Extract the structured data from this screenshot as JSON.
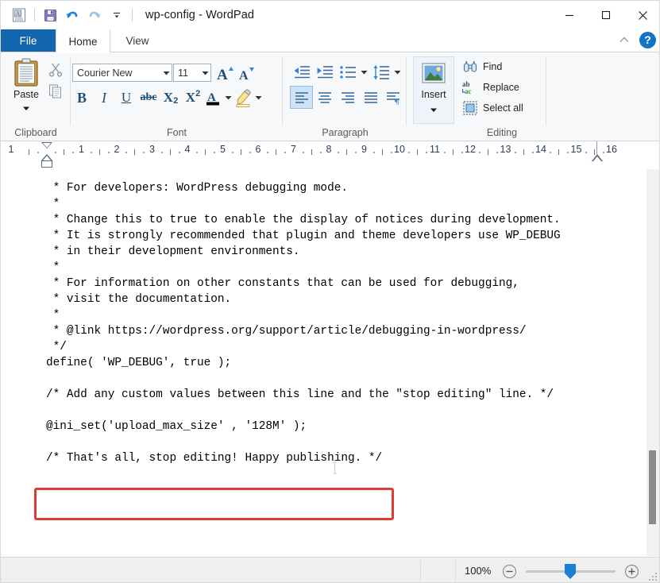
{
  "window": {
    "title": "wp-config - WordPad",
    "app_icon": "wordpad-icon",
    "minimize_label": "Minimize",
    "maximize_label": "Maximize",
    "close_label": "Close"
  },
  "quick_access": {
    "save_label": "Save",
    "undo_label": "Undo",
    "redo_label": "Redo",
    "customize_label": "Customize Quick Access Toolbar"
  },
  "tabs": [
    {
      "label": "File",
      "id": "file"
    },
    {
      "label": "Home",
      "id": "home"
    },
    {
      "label": "View",
      "id": "view"
    }
  ],
  "ribbon_right": {
    "collapse_label": "Collapse the Ribbon",
    "help_label": "?"
  },
  "ribbon": {
    "groups": [
      {
        "label": "Clipboard"
      },
      {
        "label": "Font"
      },
      {
        "label": "Paragraph"
      },
      {
        "label": ""
      },
      {
        "label": "Editing"
      }
    ],
    "clipboard": {
      "paste_label": "Paste",
      "cut_label": "Cut",
      "copy_label": "Copy"
    },
    "font": {
      "font_name": "Courier New",
      "font_name_placeholder": "Font",
      "font_size": "11",
      "font_size_placeholder": "Size",
      "grow_label": "Grow font",
      "shrink_label": "Shrink font",
      "bold_label": "B",
      "italic_label": "I",
      "underline_label": "U",
      "strikethrough_label": "abc",
      "subscript_label": "X",
      "subscript_sub": "2",
      "superscript_label": "X",
      "superscript_sup": "2",
      "text_color_label": "A",
      "highlight_label": "Text highlight color"
    },
    "paragraph": {
      "decrease_indent_label": "Decrease indent",
      "increase_indent_label": "Increase indent",
      "bullets_label": "Start a list",
      "line_spacing_label": "Line spacing",
      "align_left_label": "Align left",
      "align_center_label": "Center",
      "align_right_label": "Align right",
      "justify_label": "Justify",
      "paragraph_settings_label": "Paragraph"
    },
    "insert": {
      "label": "Insert"
    },
    "editing": {
      "find_label": "Find",
      "replace_label": "Replace",
      "select_all_label": "Select all"
    }
  },
  "ruler": {
    "numbers": [
      "1",
      "1",
      "2",
      "3",
      "4",
      "5",
      "6",
      "7",
      "8",
      "9",
      "10",
      "11",
      "12",
      "13",
      "14",
      "15",
      "16"
    ],
    "left_indent_label": "First line indent",
    "right_indent_label": "Right indent"
  },
  "document": {
    "lines": [
      " * For developers: WordPress debugging mode.",
      " *",
      " * Change this to true to enable the display of notices during development.",
      " * It is strongly recommended that plugin and theme developers use WP_DEBUG",
      " * in their development environments.",
      " *",
      " * For information on other constants that can be used for debugging,",
      " * visit the documentation.",
      " *",
      " * @link https://wordpress.org/support/article/debugging-in-wordpress/",
      " */",
      "define( 'WP_DEBUG', true );",
      "",
      "/* Add any custom values between this line and the \"stop editing\" line. */",
      "",
      "@ini_set('upload_max_size' , '128M' );",
      "",
      "/* That's all, stop editing! Happy publishing. */"
    ],
    "highlighted_line": "@ini_set('upload_max_size' , '128M' );",
    "highlight_color": "#e03b35"
  },
  "status_bar": {
    "zoom_level": "100%",
    "zoom_out_label": "Zoom out",
    "zoom_in_label": "Zoom in",
    "zoom_slider_label": "Zoom slider"
  },
  "colors": {
    "accent": "#1266ad",
    "ribbon_bg": "#f7f8f9",
    "highlight_red": "#e03b35",
    "slider_blue": "#1b7fd4"
  }
}
